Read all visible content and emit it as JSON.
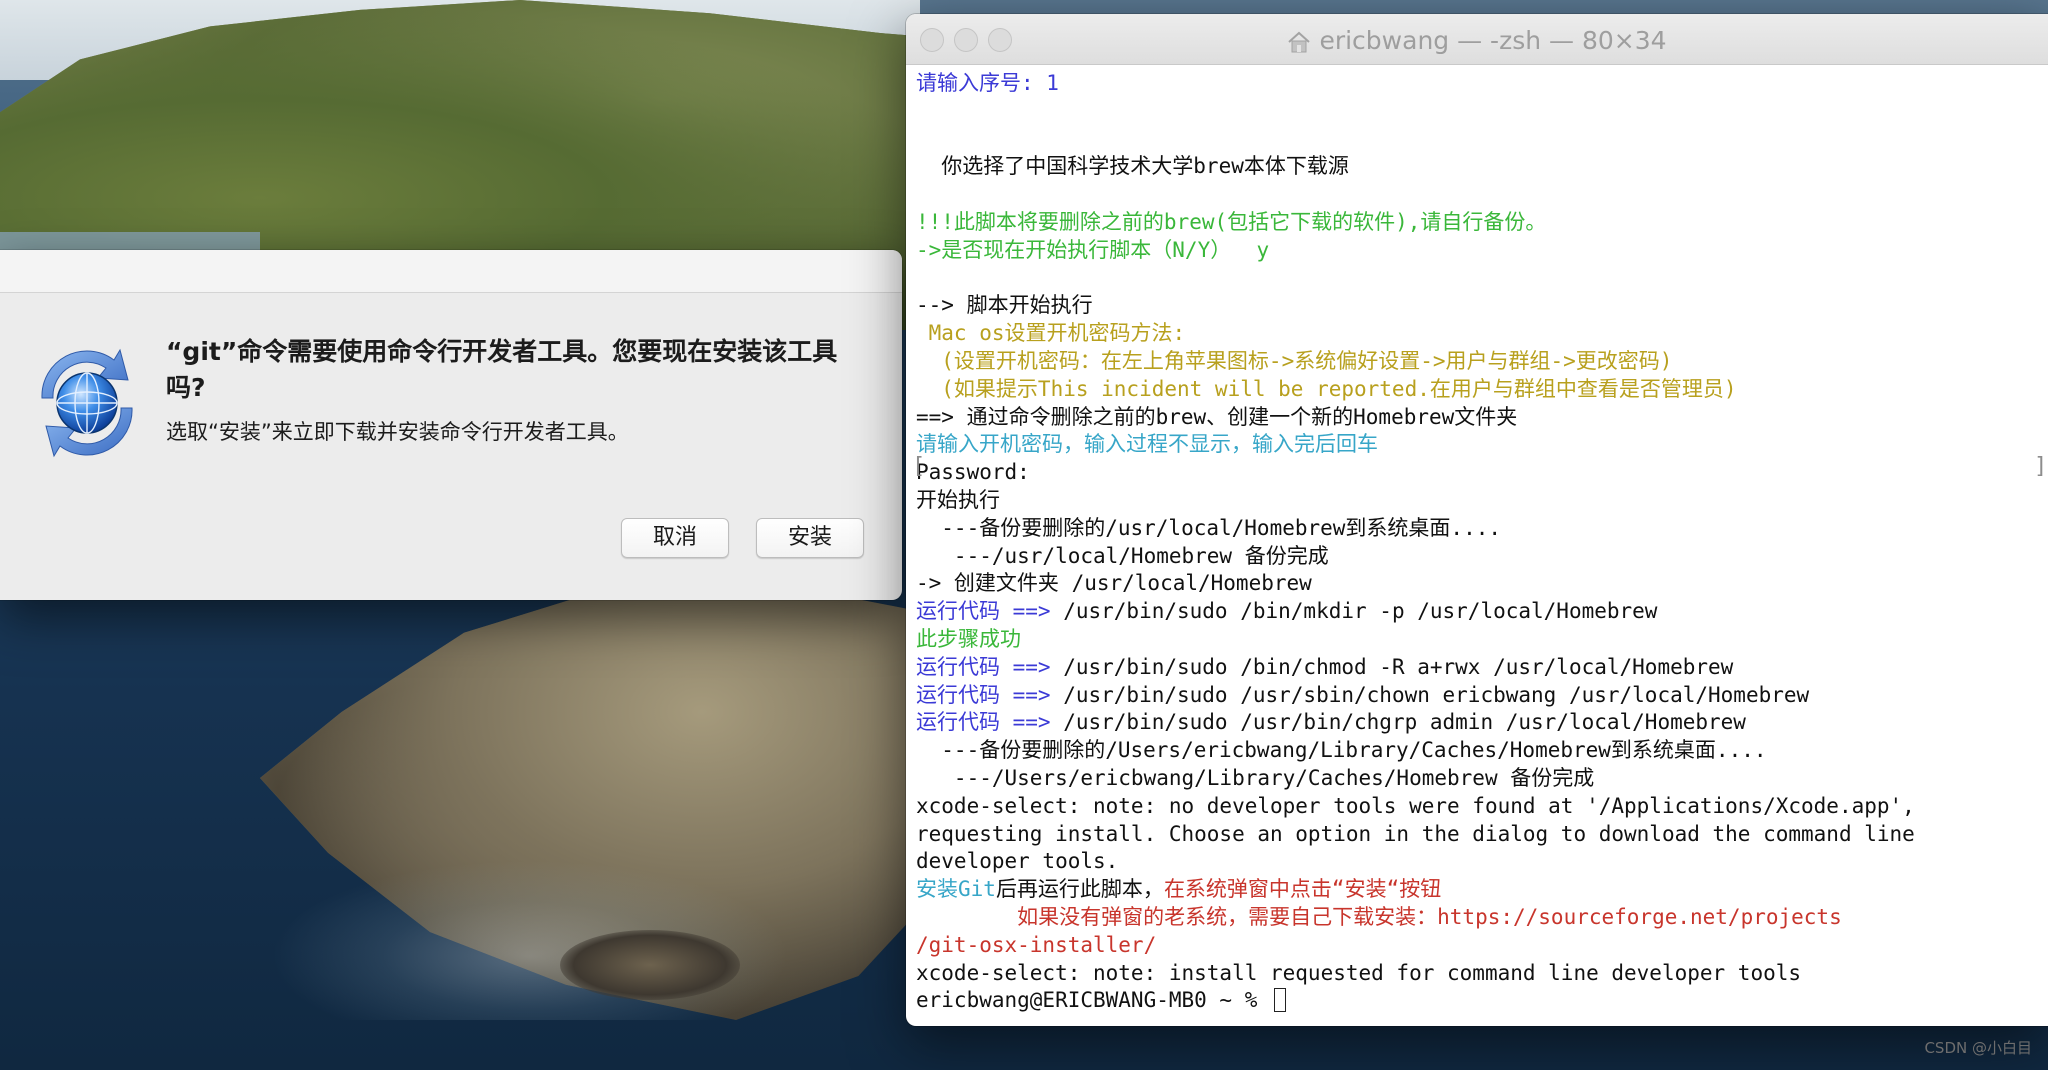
{
  "dialog": {
    "title": "“git”命令需要使用命令行开发者工具。您要现在安装该工具吗?",
    "message": "选取“安装”来立即下载并安装命令行开发者工具。",
    "cancel_label": "取消",
    "install_label": "安装"
  },
  "terminal": {
    "title": "ericbwang — -zsh — 80×34",
    "lines": [
      [
        {
          "t": "请输入序号: 1",
          "c": "blue"
        }
      ],
      [
        {
          "t": "",
          "c": "black"
        }
      ],
      [
        {
          "t": "",
          "c": "black"
        }
      ],
      [
        {
          "t": "  你选择了中国科学技术大学brew本体下载源",
          "c": "black"
        }
      ],
      [
        {
          "t": "",
          "c": "black"
        }
      ],
      [
        {
          "t": "!!!此脚本将要删除之前的brew(包括它下载的软件),请自行备份。",
          "c": "green"
        }
      ],
      [
        {
          "t": "->是否现在开始执行脚本（N/Y）  y",
          "c": "green"
        }
      ],
      [
        {
          "t": "",
          "c": "black"
        }
      ],
      [
        {
          "t": "--> 脚本开始执行",
          "c": "black"
        }
      ],
      [
        {
          "t": " Mac os设置开机密码方法:",
          "c": "yellow"
        }
      ],
      [
        {
          "t": "  (设置开机密码：在左上角苹果图标->系统偏好设置->用户与群组->更改密码)",
          "c": "yellow"
        }
      ],
      [
        {
          "t": "  (如果提示This incident will be reported.在用户与群组中查看是否管理员)",
          "c": "yellow"
        }
      ],
      [
        {
          "t": "==> 通过命令删除之前的brew、创建一个新的Homebrew文件夹",
          "c": "black"
        }
      ],
      [
        {
          "t": "请输入开机密码，输入过程不显示，输入完后回车",
          "c": "cyan"
        }
      ],
      [
        {
          "t": "Password:",
          "c": "black"
        }
      ],
      [
        {
          "t": "开始执行",
          "c": "black"
        }
      ],
      [
        {
          "t": "  ---备份要删除的/usr/local/Homebrew到系统桌面....",
          "c": "black"
        }
      ],
      [
        {
          "t": "   ---/usr/local/Homebrew 备份完成",
          "c": "black"
        }
      ],
      [
        {
          "t": "-> 创建文件夹 /usr/local/Homebrew",
          "c": "black"
        }
      ],
      [
        {
          "t": "运行代码 ==> ",
          "c": "blue"
        },
        {
          "t": "/usr/bin/sudo /bin/mkdir -p /usr/local/Homebrew",
          "c": "black"
        }
      ],
      [
        {
          "t": "此步骤成功",
          "c": "green"
        }
      ],
      [
        {
          "t": "运行代码 ==> ",
          "c": "blue"
        },
        {
          "t": "/usr/bin/sudo /bin/chmod -R a+rwx /usr/local/Homebrew",
          "c": "black"
        }
      ],
      [
        {
          "t": "运行代码 ==> ",
          "c": "blue"
        },
        {
          "t": "/usr/bin/sudo /usr/sbin/chown ericbwang /usr/local/Homebrew",
          "c": "black"
        }
      ],
      [
        {
          "t": "运行代码 ==> ",
          "c": "blue"
        },
        {
          "t": "/usr/bin/sudo /usr/bin/chgrp admin /usr/local/Homebrew",
          "c": "black"
        }
      ],
      [
        {
          "t": "  ---备份要删除的/Users/ericbwang/Library/Caches/Homebrew到系统桌面....",
          "c": "black"
        }
      ],
      [
        {
          "t": "   ---/Users/ericbwang/Library/Caches/Homebrew 备份完成",
          "c": "black"
        }
      ],
      [
        {
          "t": "xcode-select: note: no developer tools were found at '/Applications/Xcode.app',",
          "c": "black"
        }
      ],
      [
        {
          "t": "requesting install. Choose an option in the dialog to download the command line",
          "c": "black"
        }
      ],
      [
        {
          "t": "developer tools.",
          "c": "black"
        }
      ],
      [
        {
          "t": "安装Git",
          "c": "cyan"
        },
        {
          "t": "后再运行此脚本，",
          "c": "black"
        },
        {
          "t": "在系统弹窗中点击“安装“按钮",
          "c": "red"
        }
      ],
      [
        {
          "t": "        如果没有弹窗的老系统，需要自己下载安装：https://sourceforge.net/projects",
          "c": "red"
        }
      ],
      [
        {
          "t": "/git-osx-installer/",
          "c": "red"
        }
      ],
      [
        {
          "t": "xcode-select: note: install requested for command line developer tools",
          "c": "black"
        }
      ],
      [
        {
          "t": "ericbwang@ERICBWANG-MB0 ~ % ",
          "c": "black"
        }
      ]
    ],
    "password_brackets": [
      "[",
      "]"
    ]
  },
  "watermark": "CSDN @小白目",
  "colors": {
    "blue": "#3b3ad6",
    "green": "#3ab73a",
    "yellow": "#b8a01e",
    "cyan": "#37a6c8",
    "red": "#c8352c",
    "black": "#111111"
  },
  "icons": {
    "dialog_icon": "software-update-globe-icon",
    "title_icon": "home-folder-icon"
  }
}
